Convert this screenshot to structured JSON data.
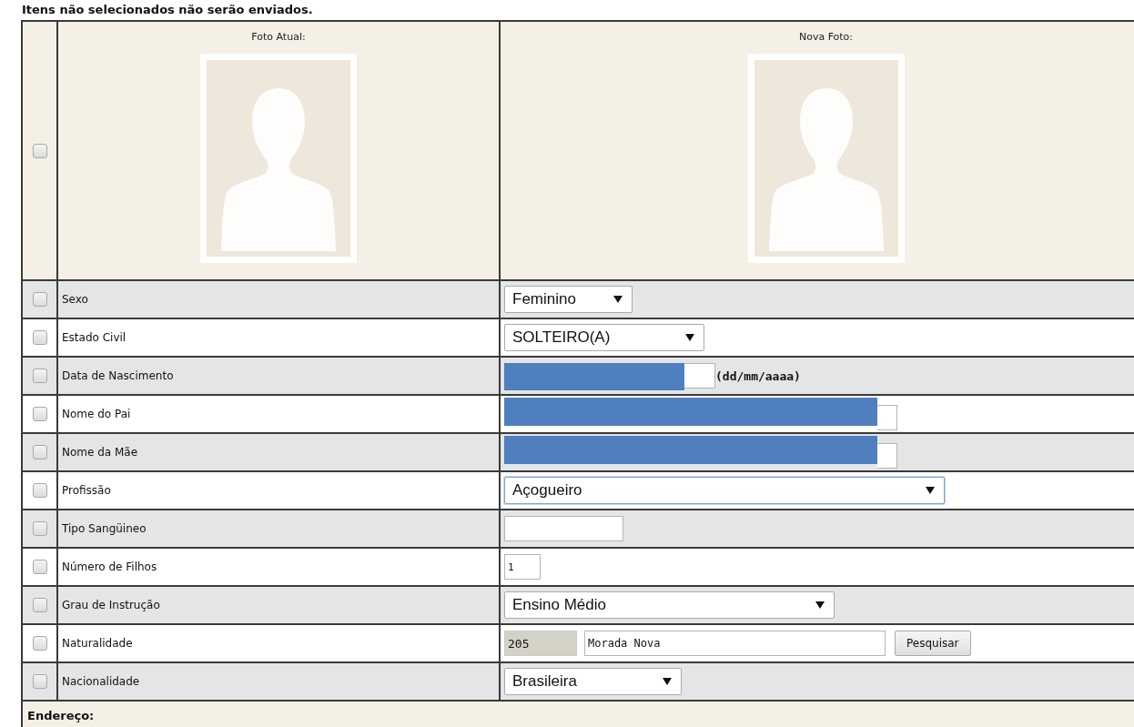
{
  "notice": "Itens não selecionados não serão enviados.",
  "photos": {
    "checked": false,
    "current_label": "Foto Atual:",
    "new_label": "Nova Foto:"
  },
  "rows": [
    {
      "label": "Sexo",
      "checked": false,
      "kind": "select",
      "value": "Feminino"
    },
    {
      "label": "Estado Civil",
      "checked": false,
      "kind": "select",
      "value": "SOLTEIRO(A)"
    },
    {
      "label": "Data de Nascimento",
      "checked": false,
      "kind": "date",
      "redacted": true,
      "hint": "(dd/mm/aaaa)"
    },
    {
      "label": "Nome do Pai",
      "checked": false,
      "kind": "input",
      "redacted": true
    },
    {
      "label": "Nome da Mãe",
      "checked": false,
      "kind": "input",
      "redacted": true
    },
    {
      "label": "Profissão",
      "checked": false,
      "kind": "select",
      "value": "Açogueiro",
      "focused": true
    },
    {
      "label": "Tipo Sangüineo",
      "checked": false,
      "kind": "input"
    },
    {
      "label": "Número de Filhos",
      "checked": false,
      "kind": "input",
      "value": "1"
    },
    {
      "label": "Grau de Instrução",
      "checked": false,
      "kind": "select",
      "value": "Ensino Médio"
    },
    {
      "label": "Naturalidade",
      "checked": false,
      "kind": "lookup",
      "code": "205",
      "value": "Morada Nova",
      "button": "Pesquisar"
    },
    {
      "label": "Nacionalidade",
      "checked": false,
      "kind": "select",
      "value": "Brasileira"
    }
  ],
  "section": "Endereço:"
}
